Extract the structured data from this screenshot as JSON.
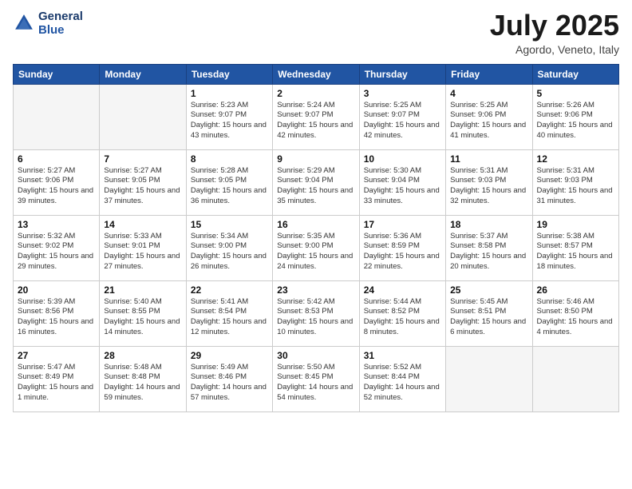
{
  "header": {
    "logo_line1": "General",
    "logo_line2": "Blue",
    "month": "July 2025",
    "location": "Agordo, Veneto, Italy"
  },
  "weekdays": [
    "Sunday",
    "Monday",
    "Tuesday",
    "Wednesday",
    "Thursday",
    "Friday",
    "Saturday"
  ],
  "weeks": [
    [
      {
        "day": "",
        "empty": true
      },
      {
        "day": "",
        "empty": true
      },
      {
        "day": "1",
        "sunrise": "5:23 AM",
        "sunset": "9:07 PM",
        "daylight": "15 hours and 43 minutes."
      },
      {
        "day": "2",
        "sunrise": "5:24 AM",
        "sunset": "9:07 PM",
        "daylight": "15 hours and 42 minutes."
      },
      {
        "day": "3",
        "sunrise": "5:25 AM",
        "sunset": "9:07 PM",
        "daylight": "15 hours and 42 minutes."
      },
      {
        "day": "4",
        "sunrise": "5:25 AM",
        "sunset": "9:06 PM",
        "daylight": "15 hours and 41 minutes."
      },
      {
        "day": "5",
        "sunrise": "5:26 AM",
        "sunset": "9:06 PM",
        "daylight": "15 hours and 40 minutes."
      }
    ],
    [
      {
        "day": "6",
        "sunrise": "5:27 AM",
        "sunset": "9:06 PM",
        "daylight": "15 hours and 39 minutes."
      },
      {
        "day": "7",
        "sunrise": "5:27 AM",
        "sunset": "9:05 PM",
        "daylight": "15 hours and 37 minutes."
      },
      {
        "day": "8",
        "sunrise": "5:28 AM",
        "sunset": "9:05 PM",
        "daylight": "15 hours and 36 minutes."
      },
      {
        "day": "9",
        "sunrise": "5:29 AM",
        "sunset": "9:04 PM",
        "daylight": "15 hours and 35 minutes."
      },
      {
        "day": "10",
        "sunrise": "5:30 AM",
        "sunset": "9:04 PM",
        "daylight": "15 hours and 33 minutes."
      },
      {
        "day": "11",
        "sunrise": "5:31 AM",
        "sunset": "9:03 PM",
        "daylight": "15 hours and 32 minutes."
      },
      {
        "day": "12",
        "sunrise": "5:31 AM",
        "sunset": "9:03 PM",
        "daylight": "15 hours and 31 minutes."
      }
    ],
    [
      {
        "day": "13",
        "sunrise": "5:32 AM",
        "sunset": "9:02 PM",
        "daylight": "15 hours and 29 minutes."
      },
      {
        "day": "14",
        "sunrise": "5:33 AM",
        "sunset": "9:01 PM",
        "daylight": "15 hours and 27 minutes."
      },
      {
        "day": "15",
        "sunrise": "5:34 AM",
        "sunset": "9:00 PM",
        "daylight": "15 hours and 26 minutes."
      },
      {
        "day": "16",
        "sunrise": "5:35 AM",
        "sunset": "9:00 PM",
        "daylight": "15 hours and 24 minutes."
      },
      {
        "day": "17",
        "sunrise": "5:36 AM",
        "sunset": "8:59 PM",
        "daylight": "15 hours and 22 minutes."
      },
      {
        "day": "18",
        "sunrise": "5:37 AM",
        "sunset": "8:58 PM",
        "daylight": "15 hours and 20 minutes."
      },
      {
        "day": "19",
        "sunrise": "5:38 AM",
        "sunset": "8:57 PM",
        "daylight": "15 hours and 18 minutes."
      }
    ],
    [
      {
        "day": "20",
        "sunrise": "5:39 AM",
        "sunset": "8:56 PM",
        "daylight": "15 hours and 16 minutes."
      },
      {
        "day": "21",
        "sunrise": "5:40 AM",
        "sunset": "8:55 PM",
        "daylight": "15 hours and 14 minutes."
      },
      {
        "day": "22",
        "sunrise": "5:41 AM",
        "sunset": "8:54 PM",
        "daylight": "15 hours and 12 minutes."
      },
      {
        "day": "23",
        "sunrise": "5:42 AM",
        "sunset": "8:53 PM",
        "daylight": "15 hours and 10 minutes."
      },
      {
        "day": "24",
        "sunrise": "5:44 AM",
        "sunset": "8:52 PM",
        "daylight": "15 hours and 8 minutes."
      },
      {
        "day": "25",
        "sunrise": "5:45 AM",
        "sunset": "8:51 PM",
        "daylight": "15 hours and 6 minutes."
      },
      {
        "day": "26",
        "sunrise": "5:46 AM",
        "sunset": "8:50 PM",
        "daylight": "15 hours and 4 minutes."
      }
    ],
    [
      {
        "day": "27",
        "sunrise": "5:47 AM",
        "sunset": "8:49 PM",
        "daylight": "15 hours and 1 minute."
      },
      {
        "day": "28",
        "sunrise": "5:48 AM",
        "sunset": "8:48 PM",
        "daylight": "14 hours and 59 minutes."
      },
      {
        "day": "29",
        "sunrise": "5:49 AM",
        "sunset": "8:46 PM",
        "daylight": "14 hours and 57 minutes."
      },
      {
        "day": "30",
        "sunrise": "5:50 AM",
        "sunset": "8:45 PM",
        "daylight": "14 hours and 54 minutes."
      },
      {
        "day": "31",
        "sunrise": "5:52 AM",
        "sunset": "8:44 PM",
        "daylight": "14 hours and 52 minutes."
      },
      {
        "day": "",
        "empty": true
      },
      {
        "day": "",
        "empty": true
      }
    ]
  ]
}
